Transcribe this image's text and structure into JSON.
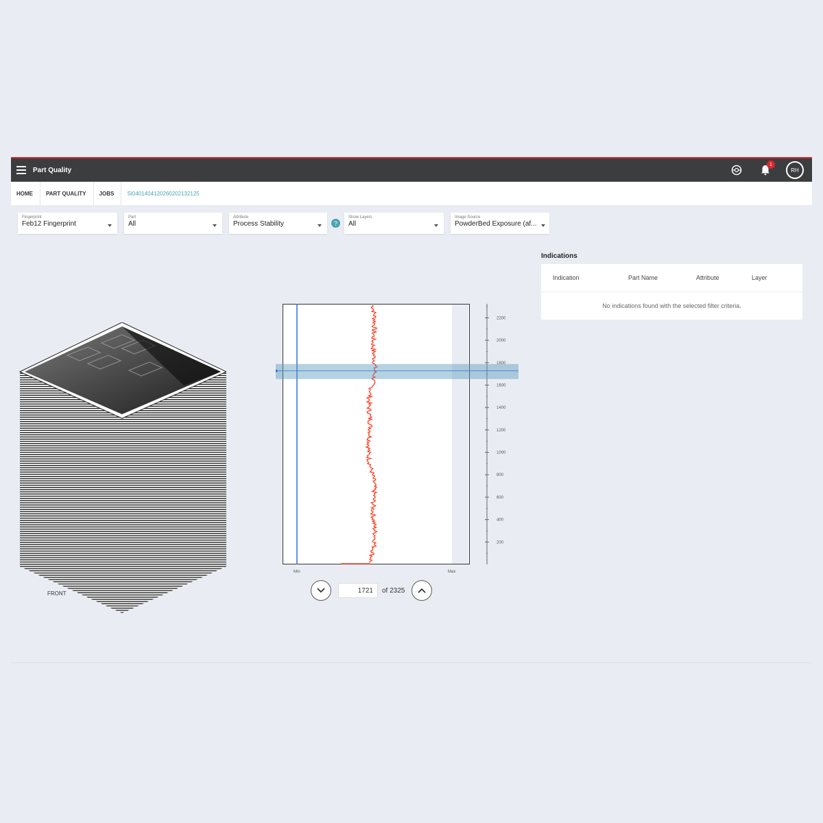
{
  "app": {
    "title": "Part Quality",
    "notifications": "1",
    "avatar": "RH"
  },
  "breadcrumbs": [
    "HOME",
    "PART QUALITY",
    "JOBS",
    "SI0401404120260202132125"
  ],
  "filters": [
    {
      "label": "Fingerprint",
      "value": "Feb12 Fingerprint",
      "width": 145
    },
    {
      "label": "Part",
      "value": "All",
      "width": 145
    },
    {
      "label": "Attribute",
      "value": "Process Stability",
      "width": 145
    },
    {
      "label": "Show Layers",
      "value": "All",
      "width": 145
    },
    {
      "label": "Image Source",
      "value": "PowderBed Exposure (af...",
      "width": 145
    }
  ],
  "indications": {
    "title": "Indications",
    "columns": [
      "Indication",
      "Part Name",
      "Attribute",
      "Layer"
    ],
    "empty": "No indications found with the selected filter criteria."
  },
  "stack": {
    "front_label": "FRONT"
  },
  "chart_data": {
    "type": "line",
    "orientation": "vertical",
    "y_ticks": [
      200,
      400,
      600,
      800,
      1000,
      1200,
      1400,
      1600,
      1800,
      2000,
      2200
    ],
    "ylim": [
      0,
      2325
    ],
    "x_labels": [
      "Min",
      "Max"
    ],
    "selected_layer": 1721,
    "series": [
      {
        "color": "#ff3b1f"
      }
    ]
  },
  "layer_nav": {
    "current": "1721",
    "of_text": "of 2325"
  }
}
